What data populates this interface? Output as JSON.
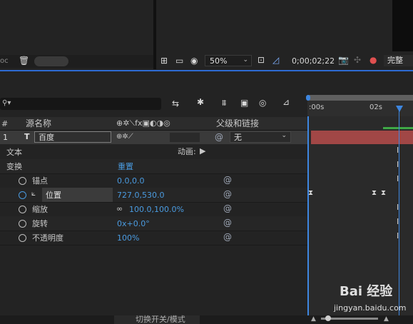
{
  "project_panel": {
    "partial_label": "oc",
    "trash_icon": "trash-icon"
  },
  "viewer": {
    "zoom": "50%",
    "timecode": "0;00;02;22",
    "quality": "完整",
    "icons": [
      "grid-icon",
      "monitor-icon",
      "mask-icon",
      "region-of-interest-icon",
      "transparency-grid-icon",
      "camera-icon",
      "show-channel-icon",
      "color-icon"
    ]
  },
  "timeline": {
    "search_placeholder": "",
    "toolbar_icons": [
      "draft-3d-icon",
      "shy-icon",
      "frame-blending-icon",
      "motion-blur-icon",
      "graph-editor-icon"
    ],
    "ruler": {
      "label_0": ":00s",
      "label_2": "02s"
    },
    "columns": {
      "hash": "#",
      "source_name": "源名称",
      "parent": "父级和链接"
    },
    "layer": {
      "index": "1",
      "type_icon": "T",
      "name": "百度",
      "parent": "无"
    },
    "properties": [
      {
        "label": "文本",
        "value": "",
        "extra": "动画:"
      },
      {
        "label": "变换",
        "value": "重置"
      },
      {
        "label": "锚点",
        "value": "0.0,0.0"
      },
      {
        "label": "位置",
        "value": "727.0,530.0"
      },
      {
        "label": "缩放",
        "value": "100.0,100.0%"
      },
      {
        "label": "旋转",
        "value": "0x+0.0°"
      },
      {
        "label": "不透明度",
        "value": "100%"
      }
    ],
    "footer_label": "切换开关/模式"
  },
  "watermark": {
    "text": "Bai 经验",
    "url": "jingyan.baidu.com"
  }
}
